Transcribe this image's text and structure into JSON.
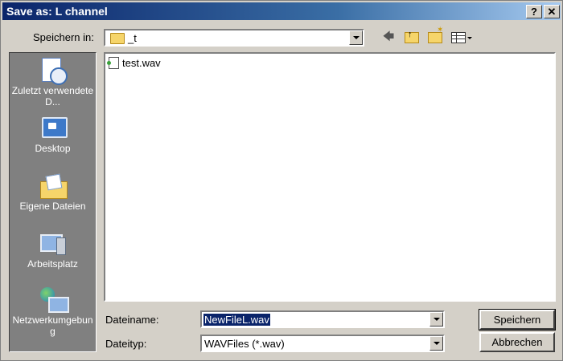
{
  "window": {
    "title": "Save as: L channel",
    "help_label": "?",
    "close_label": "✕"
  },
  "lookin": {
    "label": "Speichern in:",
    "value": "_t"
  },
  "toolbar": {
    "back_icon": "back-arrow-icon",
    "up_icon": "folder-up-icon",
    "new_folder_icon": "new-folder-icon",
    "views_icon": "views-menu-icon"
  },
  "places": [
    {
      "label": "Zuletzt verwendete D...",
      "icon": "recent-documents-icon"
    },
    {
      "label": "Desktop",
      "icon": "desktop-icon"
    },
    {
      "label": "Eigene Dateien",
      "icon": "my-documents-icon"
    },
    {
      "label": "Arbeitsplatz",
      "icon": "my-computer-icon"
    },
    {
      "label": "Netzwerkumgebung",
      "icon": "network-places-icon"
    }
  ],
  "files": [
    {
      "name": "test.wav",
      "icon": "wav-file-icon"
    }
  ],
  "filename": {
    "label": "Dateiname:",
    "value": "NewFileL.wav"
  },
  "filetype": {
    "label": "Dateityp:",
    "value": "WAVFiles (*.wav)"
  },
  "buttons": {
    "save": "Speichern",
    "cancel": "Abbrechen"
  }
}
